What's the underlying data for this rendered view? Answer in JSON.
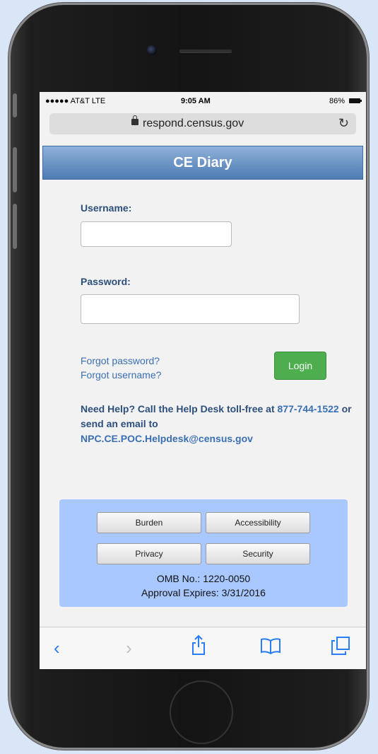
{
  "status_bar": {
    "carrier": "●●●●● AT&T  LTE",
    "time": "9:05 AM",
    "battery": "86%"
  },
  "browser": {
    "url": "respond.census.gov"
  },
  "banner": {
    "title": "CE Diary"
  },
  "form": {
    "username_label": "Username:",
    "username_value": "",
    "password_label": "Password:",
    "password_value": "",
    "forgot_password": "Forgot password?",
    "forgot_username": "Forgot username?",
    "login_label": "Login"
  },
  "help": {
    "text_before": "Need Help? Call the Help Desk toll-free at ",
    "phone": "877-744-1522",
    "text_middle": " or send an email to ",
    "email": "NPC.CE.POC.Helpdesk@census.gov"
  },
  "footer": {
    "buttons": [
      "Burden",
      "Accessibility",
      "Privacy",
      "Security"
    ],
    "omb": "OMB No.: 1220-0050",
    "approval": "Approval Expires: 3/31/2016"
  },
  "toolbar": {
    "icons": [
      "back-icon",
      "forward-icon",
      "share-icon",
      "bookmarks-icon",
      "tabs-icon"
    ]
  },
  "colors": {
    "banner": "#4e7cb3",
    "login": "#4cae4c",
    "footer": "#a8c8ff",
    "link": "#3a6fb3"
  }
}
